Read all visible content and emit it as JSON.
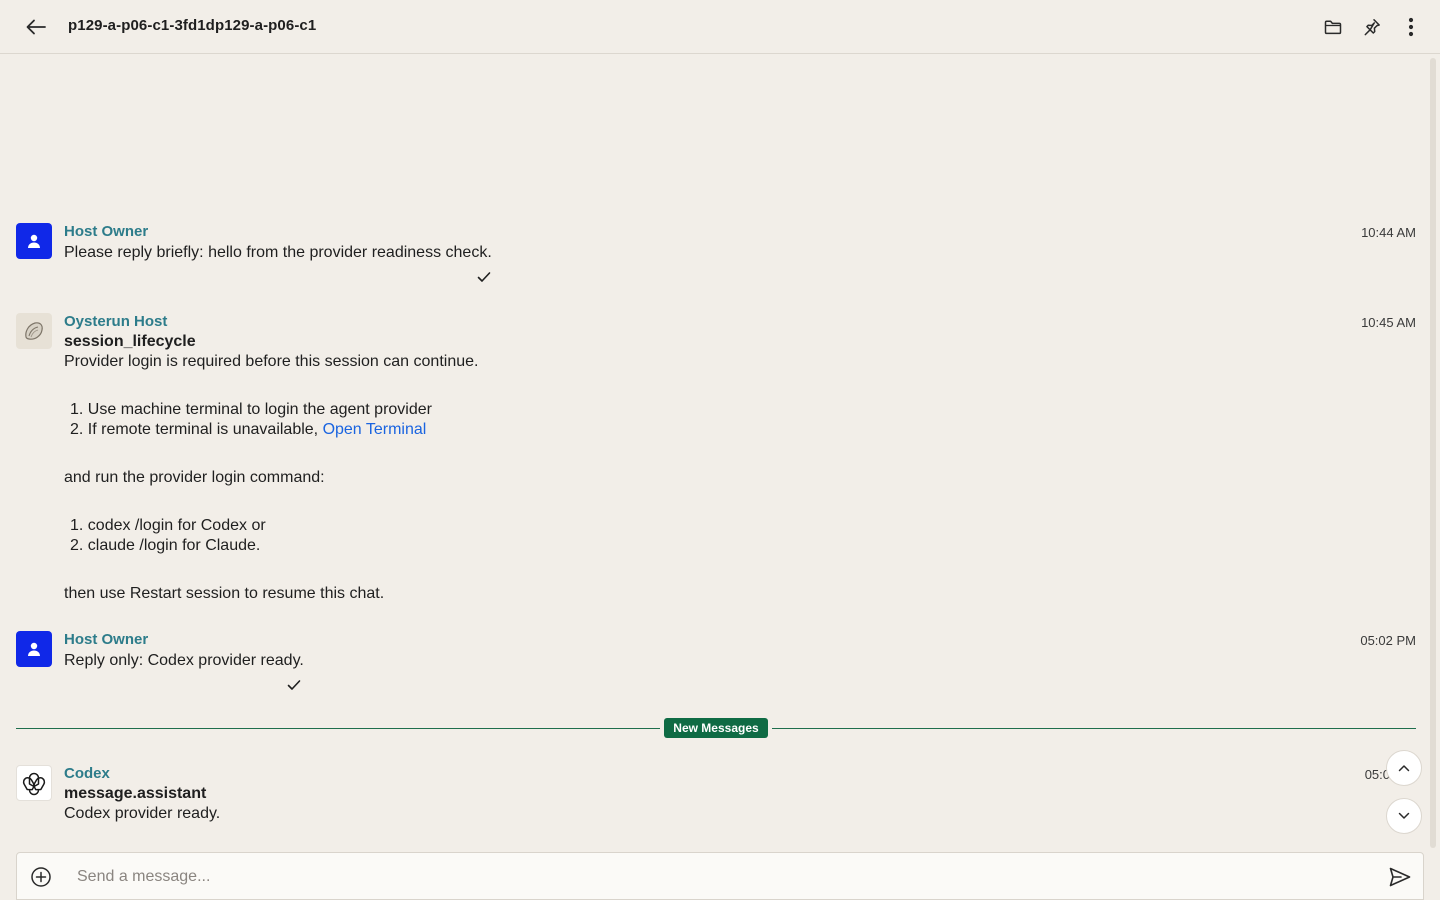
{
  "header": {
    "title": "p129-a-p06-c1-3fd1dp129-a-p06-c1",
    "icons": [
      "back-arrow-icon",
      "folder-icon",
      "pin-icon",
      "more-vertical-icon"
    ]
  },
  "messages": [
    {
      "sender": "Host Owner",
      "time": "10:44 AM",
      "text": "Please reply briefly: hello from the provider readiness check."
    },
    {
      "sender": "Oysterun Host",
      "time": "10:45 AM",
      "heading": "session_lifecycle",
      "intro": "Provider login is required before this session can continue.",
      "steps": [
        "1. Use machine terminal to login the agent provider",
        "2. If remote terminal is unavailable, "
      ],
      "link_text": "Open Terminal",
      "middle": "and run the provider login command:",
      "commands": [
        "1. codex /login for Codex or",
        "2. claude /login for Claude."
      ],
      "outro": "then use Restart session to resume this chat."
    },
    {
      "sender": "Host Owner",
      "time": "05:02 PM",
      "text": "Reply only: Codex provider ready."
    },
    {
      "sender": "Codex",
      "time": "05:0",
      "heading": "message.assistant",
      "text": "Codex provider ready."
    }
  ],
  "divider": {
    "label": "New Messages"
  },
  "composer": {
    "placeholder": "Send a message..."
  },
  "colors": {
    "background": "#f2eee8",
    "sender": "#2d7c8a",
    "user_avatar": "#1028e8",
    "new_messages": "#0f6b44",
    "link": "#1a64e0"
  }
}
